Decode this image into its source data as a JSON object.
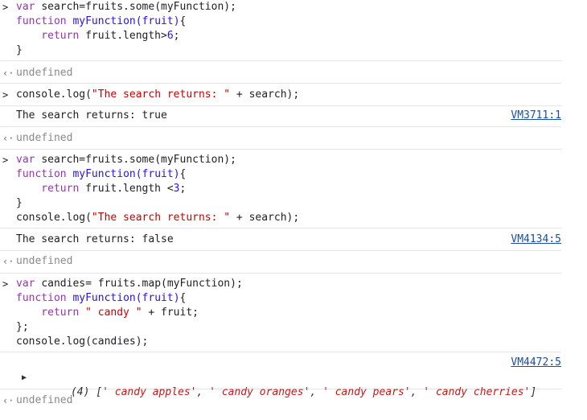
{
  "blocks": [
    {
      "input": [
        [
          {
            "t": "var ",
            "c": "keyword"
          },
          {
            "t": "search=fruits.some(myFunction);",
            "c": "plain"
          }
        ],
        [
          {
            "t": "function ",
            "c": "keyword"
          },
          {
            "t": "myFunction",
            "c": "funcname"
          },
          {
            "t": "(fruit)",
            "c": "param"
          },
          {
            "t": "{",
            "c": "plain"
          }
        ],
        [
          {
            "t": "    return ",
            "c": "keyword"
          },
          {
            "t": "fruit.length>",
            "c": "plain"
          },
          {
            "t": "6",
            "c": "funcname"
          },
          {
            "t": ";",
            "c": "plain"
          }
        ],
        [
          {
            "t": "}",
            "c": "plain"
          }
        ]
      ],
      "result": "undefined"
    },
    {
      "input": [
        [
          {
            "t": "console.log(",
            "c": "plain"
          },
          {
            "t": "\"The search returns: \"",
            "c": "strc"
          },
          {
            "t": " + search);",
            "c": "plain"
          }
        ]
      ],
      "log": {
        "text": "The search returns: true",
        "link": "VM3711:1"
      },
      "result": "undefined"
    },
    {
      "input": [
        [
          {
            "t": "var ",
            "c": "keyword"
          },
          {
            "t": "search=fruits.some(myFunction);",
            "c": "plain"
          }
        ],
        [
          {
            "t": "function ",
            "c": "keyword"
          },
          {
            "t": "myFunction",
            "c": "funcname"
          },
          {
            "t": "(fruit)",
            "c": "param"
          },
          {
            "t": "{",
            "c": "plain"
          }
        ],
        [
          {
            "t": "    return ",
            "c": "keyword"
          },
          {
            "t": "fruit.length <",
            "c": "plain"
          },
          {
            "t": "3",
            "c": "funcname"
          },
          {
            "t": ";",
            "c": "plain"
          }
        ],
        [
          {
            "t": "}",
            "c": "plain"
          }
        ],
        [
          {
            "t": "console.log(",
            "c": "plain"
          },
          {
            "t": "\"The search returns: \"",
            "c": "strc"
          },
          {
            "t": " + search);",
            "c": "plain"
          }
        ]
      ],
      "log": {
        "text": "The search returns: false",
        "link": "VM4134:5"
      },
      "result": "undefined"
    },
    {
      "input": [
        [
          {
            "t": "var ",
            "c": "keyword"
          },
          {
            "t": "candies= fruits.map(myFunction);",
            "c": "plain"
          }
        ],
        [
          {
            "t": "function ",
            "c": "keyword"
          },
          {
            "t": "myFunction",
            "c": "funcname"
          },
          {
            "t": "(fruit)",
            "c": "param"
          },
          {
            "t": "{",
            "c": "plain"
          }
        ],
        [
          {
            "t": "    return ",
            "c": "keyword"
          },
          {
            "t": "\" candy \"",
            "c": "strc"
          },
          {
            "t": " + fruit;",
            "c": "plain"
          }
        ],
        [
          {
            "t": "};",
            "c": "plain"
          }
        ],
        [
          {
            "t": "console.log(candies);",
            "c": "plain"
          }
        ]
      ],
      "log_link": "VM4472:5",
      "array": {
        "toggle": "▶",
        "count": "(4)",
        "items": [
          "' candy apples'",
          "' candy oranges'",
          "' candy pears'",
          "' candy cherries'"
        ]
      },
      "result": "undefined"
    }
  ],
  "icons": {
    "prompt": "chevron-right-icon",
    "result": "return-arrow-icon",
    "expand": "expand-triangle-icon"
  },
  "colors": {
    "keyword": "#9b30b5",
    "function": "#2a0ff0",
    "string": "#c80000",
    "link": "#1a4fa0",
    "muted": "#8a8a8a"
  },
  "glyphs": {
    "prompt": ">",
    "result": "‹·"
  }
}
